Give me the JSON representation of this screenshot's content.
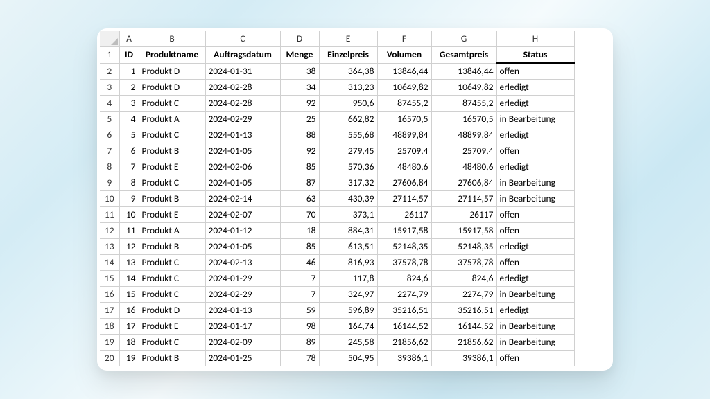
{
  "columns": [
    "A",
    "B",
    "C",
    "D",
    "E",
    "F",
    "G",
    "H"
  ],
  "headers": {
    "A": "ID",
    "B": "Produktname",
    "C": "Auftragsdatum",
    "D": "Menge",
    "E": "Einzelpreis",
    "F": "Volumen",
    "G": "Gesamtpreis",
    "H": "Status"
  },
  "row_numbers": [
    "1",
    "2",
    "3",
    "4",
    "5",
    "6",
    "7",
    "8",
    "9",
    "10",
    "11",
    "12",
    "13",
    "14",
    "15",
    "16",
    "17",
    "18",
    "19",
    "20"
  ],
  "rows": [
    {
      "A": "1",
      "B": "Produkt D",
      "C": "2024-01-31",
      "D": "38",
      "E": "364,38",
      "F": "13846,44",
      "G": "13846,44",
      "H": "offen"
    },
    {
      "A": "2",
      "B": "Produkt D",
      "C": "2024-02-28",
      "D": "34",
      "E": "313,23",
      "F": "10649,82",
      "G": "10649,82",
      "H": "erledigt"
    },
    {
      "A": "3",
      "B": "Produkt C",
      "C": "2024-02-28",
      "D": "92",
      "E": "950,6",
      "F": "87455,2",
      "G": "87455,2",
      "H": "erledigt"
    },
    {
      "A": "4",
      "B": "Produkt A",
      "C": "2024-02-29",
      "D": "25",
      "E": "662,82",
      "F": "16570,5",
      "G": "16570,5",
      "H": "in Bearbeitung"
    },
    {
      "A": "5",
      "B": "Produkt C",
      "C": "2024-01-13",
      "D": "88",
      "E": "555,68",
      "F": "48899,84",
      "G": "48899,84",
      "H": "erledigt"
    },
    {
      "A": "6",
      "B": "Produkt B",
      "C": "2024-01-05",
      "D": "92",
      "E": "279,45",
      "F": "25709,4",
      "G": "25709,4",
      "H": "offen"
    },
    {
      "A": "7",
      "B": "Produkt E",
      "C": "2024-02-06",
      "D": "85",
      "E": "570,36",
      "F": "48480,6",
      "G": "48480,6",
      "H": "erledigt"
    },
    {
      "A": "8",
      "B": "Produkt C",
      "C": "2024-01-05",
      "D": "87",
      "E": "317,32",
      "F": "27606,84",
      "G": "27606,84",
      "H": "in Bearbeitung"
    },
    {
      "A": "9",
      "B": "Produkt B",
      "C": "2024-02-14",
      "D": "63",
      "E": "430,39",
      "F": "27114,57",
      "G": "27114,57",
      "H": "in Bearbeitung"
    },
    {
      "A": "10",
      "B": "Produkt E",
      "C": "2024-02-07",
      "D": "70",
      "E": "373,1",
      "F": "26117",
      "G": "26117",
      "H": "offen"
    },
    {
      "A": "11",
      "B": "Produkt A",
      "C": "2024-01-12",
      "D": "18",
      "E": "884,31",
      "F": "15917,58",
      "G": "15917,58",
      "H": "offen"
    },
    {
      "A": "12",
      "B": "Produkt B",
      "C": "2024-01-05",
      "D": "85",
      "E": "613,51",
      "F": "52148,35",
      "G": "52148,35",
      "H": "erledigt"
    },
    {
      "A": "13",
      "B": "Produkt C",
      "C": "2024-02-13",
      "D": "46",
      "E": "816,93",
      "F": "37578,78",
      "G": "37578,78",
      "H": "offen"
    },
    {
      "A": "14",
      "B": "Produkt C",
      "C": "2024-01-29",
      "D": "7",
      "E": "117,8",
      "F": "824,6",
      "G": "824,6",
      "H": "erledigt"
    },
    {
      "A": "15",
      "B": "Produkt C",
      "C": "2024-02-29",
      "D": "7",
      "E": "324,97",
      "F": "2274,79",
      "G": "2274,79",
      "H": "in Bearbeitung"
    },
    {
      "A": "16",
      "B": "Produkt D",
      "C": "2024-01-13",
      "D": "59",
      "E": "596,89",
      "F": "35216,51",
      "G": "35216,51",
      "H": "erledigt"
    },
    {
      "A": "17",
      "B": "Produkt E",
      "C": "2024-01-17",
      "D": "98",
      "E": "164,74",
      "F": "16144,52",
      "G": "16144,52",
      "H": "in Bearbeitung"
    },
    {
      "A": "18",
      "B": "Produkt C",
      "C": "2024-02-09",
      "D": "89",
      "E": "245,58",
      "F": "21856,62",
      "G": "21856,62",
      "H": "in Bearbeitung"
    },
    {
      "A": "19",
      "B": "Produkt B",
      "C": "2024-01-25",
      "D": "78",
      "E": "504,95",
      "F": "39386,1",
      "G": "39386,1",
      "H": "offen"
    }
  ]
}
